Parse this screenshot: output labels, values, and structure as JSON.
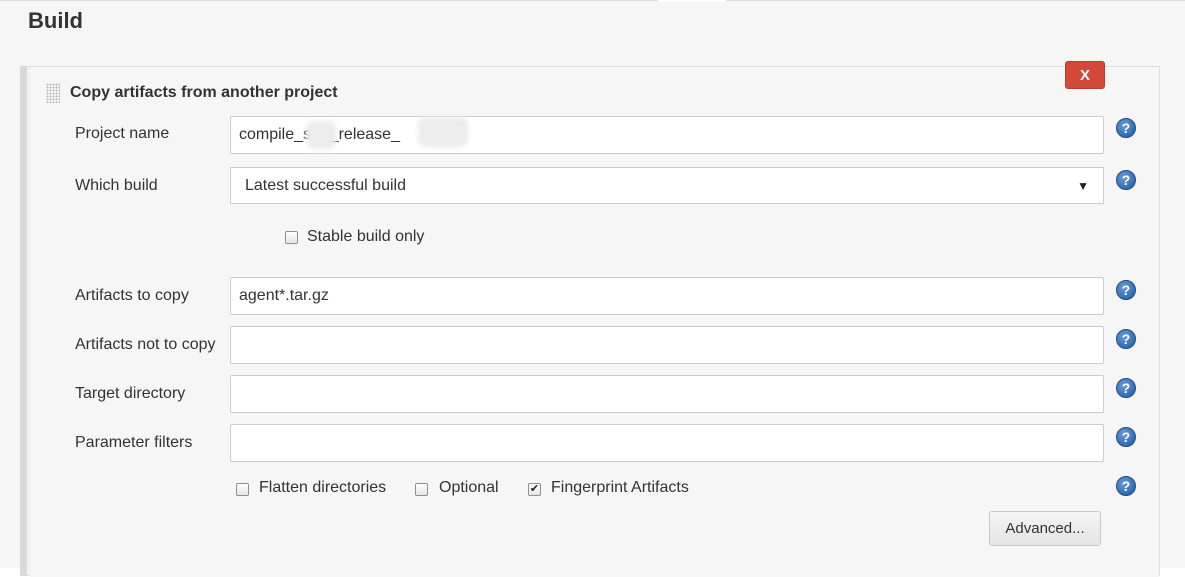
{
  "section": {
    "title": "Build"
  },
  "step": {
    "title": "Copy artifacts from another project",
    "delete_label": "X"
  },
  "fields": {
    "project_name": {
      "label": "Project name",
      "value": "compile_s    er_release_"
    },
    "which_build": {
      "label": "Which build",
      "value": "Latest successful build"
    },
    "stable_only": {
      "label": "Stable build only",
      "checked": false
    },
    "artifacts_to_copy": {
      "label": "Artifacts to copy",
      "value": "agent*.tar.gz"
    },
    "artifacts_not_to_copy": {
      "label": "Artifacts not to copy",
      "value": ""
    },
    "target_directory": {
      "label": "Target directory",
      "value": ""
    },
    "parameter_filters": {
      "label": "Parameter filters",
      "value": ""
    }
  },
  "options": {
    "flatten": {
      "label": "Flatten directories",
      "checked": false
    },
    "optional": {
      "label": "Optional",
      "checked": false
    },
    "fingerprint": {
      "label": "Fingerprint Artifacts",
      "checked": true
    }
  },
  "help_glyph": "?",
  "check_glyph": "✔",
  "dropdown_glyph": "▼",
  "advanced_label": "Advanced...",
  "colors": {
    "delete": "#d24939",
    "help": "#2f6cb3"
  }
}
